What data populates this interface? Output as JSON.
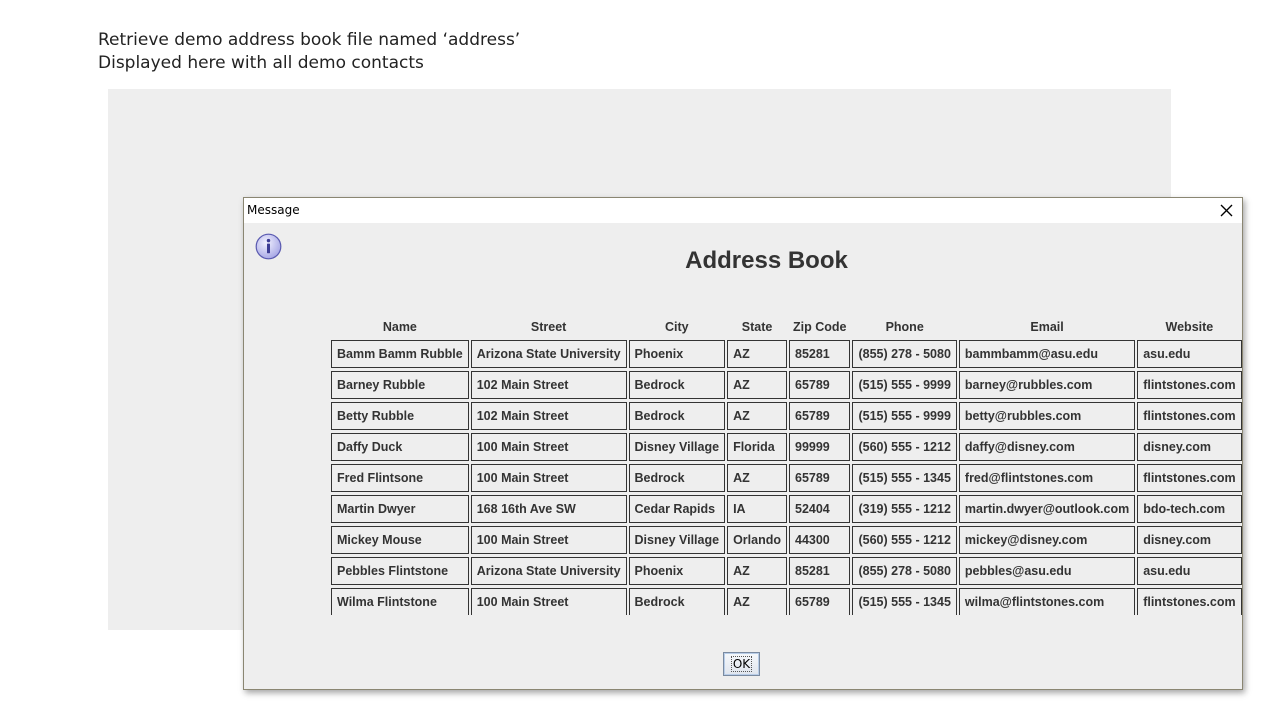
{
  "slide": {
    "caption_line1": "Retrieve demo address book file named ‘address’",
    "caption_line2": "Displayed here with all demo contacts"
  },
  "dialog": {
    "title": "Message",
    "heading": "Address Book",
    "ok_label": "OK",
    "icon": "info-icon",
    "close_icon": "close-icon"
  },
  "table": {
    "columns": [
      "Name",
      "Street",
      "City",
      "State",
      "Zip Code",
      "Phone",
      "Email",
      "Website"
    ],
    "rows": [
      [
        "Bamm Bamm Rubble",
        "Arizona State University",
        "Phoenix",
        "AZ",
        "85281",
        "(855) 278 - 5080",
        "bammbamm@asu.edu",
        "asu.edu"
      ],
      [
        "Barney Rubble",
        "102 Main Street",
        "Bedrock",
        "AZ",
        "65789",
        "(515) 555 - 9999",
        "barney@rubbles.com",
        "flintstones.com"
      ],
      [
        "Betty Rubble",
        "102 Main Street",
        "Bedrock",
        "AZ",
        "65789",
        "(515) 555 - 9999",
        "betty@rubbles.com",
        "flintstones.com"
      ],
      [
        "Daffy Duck",
        "100 Main Street",
        "Disney Village",
        "Florida",
        "99999",
        "(560) 555 - 1212",
        "daffy@disney.com",
        "disney.com"
      ],
      [
        "Fred Flintsone",
        "100 Main Street",
        "Bedrock",
        "AZ",
        "65789",
        "(515) 555 - 1345",
        "fred@flintstones.com",
        "flintstones.com"
      ],
      [
        "Martin Dwyer",
        "168 16th Ave SW",
        "Cedar Rapids",
        "IA",
        "52404",
        "(319) 555 - 1212",
        "martin.dwyer@outlook.com",
        "bdo-tech.com"
      ],
      [
        "Mickey Mouse",
        "100 Main Street",
        "Disney Village",
        "Orlando",
        "44300",
        "(560) 555 - 1212",
        "mickey@disney.com",
        "disney.com"
      ],
      [
        "Pebbles Flintstone",
        "Arizona State University",
        "Phoenix",
        "AZ",
        "85281",
        "(855) 278 - 5080",
        "pebbles@asu.edu",
        "asu.edu"
      ],
      [
        "Wilma Flintstone",
        "100 Main Street",
        "Bedrock",
        "AZ",
        "65789",
        "(515) 555 - 1345",
        "wilma@flintstones.com",
        "flintstones.com"
      ]
    ]
  },
  "colors": {
    "dialog_bg": "#eeeeee",
    "titlebar_bg": "#ffffff",
    "text": "#333333",
    "icon_fill": "#c9c9f2",
    "icon_stroke": "#5a5ab0"
  }
}
